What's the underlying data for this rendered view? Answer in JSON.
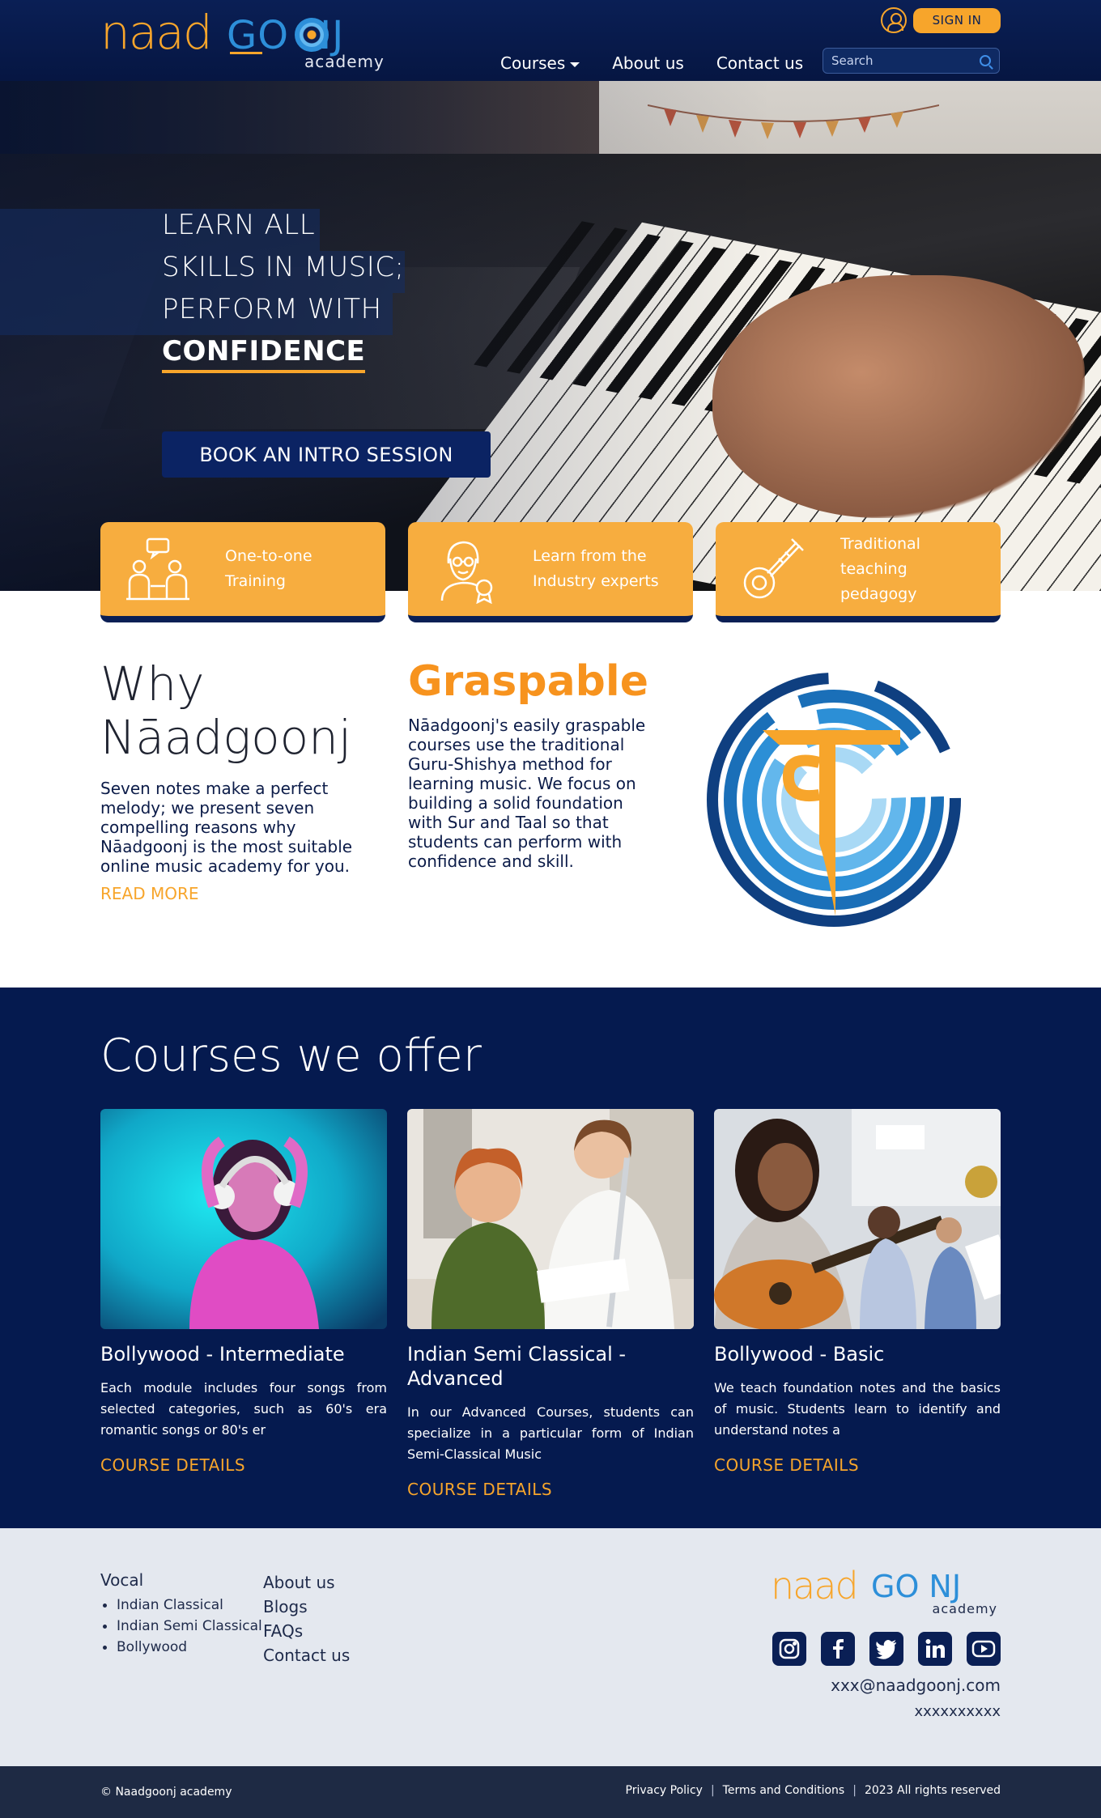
{
  "header": {
    "logo_naad": "naad",
    "logo_goonj": "GO NJ",
    "logo_academy": "academy",
    "signin_label": "SIGN IN",
    "nav": [
      "Courses",
      "About us",
      "Contact us"
    ],
    "search_placeholder": "Search"
  },
  "hero": {
    "line1": "LEARN ALL",
    "line2": "SKILLS IN MUSIC;",
    "line3": "PERFORM WITH",
    "line4": "CONFIDENCE",
    "cta_label": "BOOK AN INTRO SESSION"
  },
  "features": [
    {
      "line1": "One-to-one",
      "line2": "Training",
      "icon": "one-to-one-training-icon"
    },
    {
      "line1": "Learn from the",
      "line2": "Industry experts",
      "icon": "industry-expert-icon"
    },
    {
      "line1": "Traditional",
      "line2": "teaching pedagogy",
      "icon": "sitar-icon"
    }
  ],
  "why": {
    "title_line1": "Why",
    "title_line2": "Nāadgoonj",
    "text": "Seven notes make a perfect melody; we present seven compelling reasons why Nāadgoonj is the most suitable online music academy for you.",
    "read_more": "READ MORE"
  },
  "graspable": {
    "title": "Graspable",
    "text": "Nāadgoonj's easily graspable courses use the traditional Guru-Shishya method for learning music. We focus on building a solid foundation with Sur and Taal so that students can perform with confidence and skill."
  },
  "courses": {
    "title": "Courses we offer",
    "items": [
      {
        "name": "Bollywood - Intermediate",
        "desc": "Each module includes four songs from selected categories, such as 60's era romantic songs or 80's er",
        "link": "COURSE DETAILS"
      },
      {
        "name": "Indian Semi Classical - Advanced",
        "desc": "In our Advanced Courses, students can specialize in a particular form of Indian Semi-Classical Music",
        "link": "COURSE DETAILS"
      },
      {
        "name": "Bollywood - Basic",
        "desc": "We teach foundation notes and the basics of music. Students learn to identify and understand notes a",
        "link": "COURSE DETAILS"
      }
    ]
  },
  "footer": {
    "vocal_heading": "Vocal",
    "vocal_items": [
      "Indian Classical",
      "Indian Semi Classical",
      "Bollywood"
    ],
    "links": [
      "About us",
      "Blogs",
      "FAQs",
      "Contact us"
    ],
    "logo_naad": "naad",
    "logo_goonj": "GO NJ",
    "logo_academy": "academy",
    "email": "xxx@naadgoonj.com",
    "phone": "xxxxxxxxxx",
    "socials": [
      "instagram-icon",
      "facebook-icon",
      "twitter-icon",
      "linkedin-icon",
      "youtube-icon"
    ]
  },
  "bottom_bar": {
    "copyright": "© Naadgoonj academy",
    "privacy": "Privacy Policy",
    "terms": "Terms and Conditions",
    "rights": "2023 All rights reserved"
  },
  "colors": {
    "navy": "#051a4f",
    "orange": "#f7a52b",
    "footer_bg": "#e4e8ef"
  }
}
